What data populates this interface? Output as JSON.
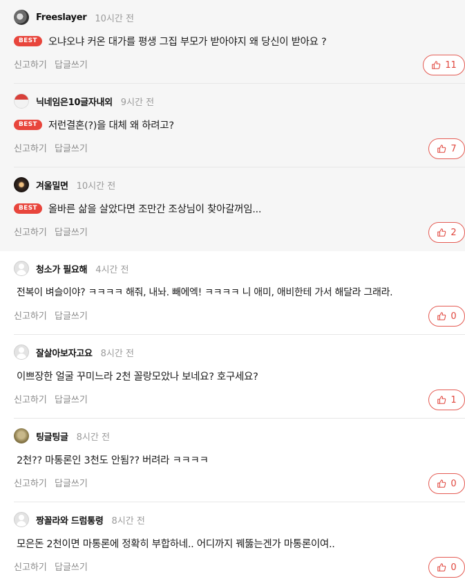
{
  "comments": [
    {
      "nick": "Freeslayer",
      "time": "10시간 전",
      "best": true,
      "badge": "BEST",
      "text": "오냐오냐 커온 대가를 평생 그집 부모가 받아야지 왜 당신이 받아요 ?",
      "report": "신고하기",
      "reply": "답글쓰기",
      "likes": "11"
    },
    {
      "nick": "닉네임은10글자내외",
      "time": "9시간 전",
      "best": true,
      "badge": "BEST",
      "text": "저런결혼(?)을 대체 왜 하려고?",
      "report": "신고하기",
      "reply": "답글쓰기",
      "likes": "7"
    },
    {
      "nick": "겨울밀면",
      "time": "10시간 전",
      "best": true,
      "badge": "BEST",
      "text": "올바른 삶을 살았다면 조만간 조상님이 찾아갈꺼임...",
      "report": "신고하기",
      "reply": "답글쓰기",
      "likes": "2"
    },
    {
      "nick": "청소가 필요해",
      "time": "4시간 전",
      "best": false,
      "text": "전복이 벼슬이야? ㅋㅋㅋㅋ 해줘, 내놔. 빼에엑! ㅋㅋㅋㅋ 니 애미, 애비한테 가서 해달라 그래라.",
      "report": "신고하기",
      "reply": "답글쓰기",
      "likes": "0"
    },
    {
      "nick": "잘살아보자고요",
      "time": "8시간 전",
      "best": false,
      "text": "이쁘장한 얼굴 꾸미느라 2천 꼴랑모았나 보네요? 호구세요?",
      "report": "신고하기",
      "reply": "답글쓰기",
      "likes": "1"
    },
    {
      "nick": "팅글팅글",
      "time": "8시간 전",
      "best": false,
      "text": "2천?? 마통론인 3천도 안됨?? 버려라 ㅋㅋㅋㅋ",
      "report": "신고하기",
      "reply": "답글쓰기",
      "likes": "0"
    },
    {
      "nick": "짱꼴라와 드럼통령",
      "time": "8시간 전",
      "best": false,
      "text": "모은돈 2천이면 마통론에 정확히 부합하네.. 어디까지 꿰뚫는겐가 마통론이여..",
      "report": "신고하기",
      "reply": "답글쓰기",
      "likes": "0"
    }
  ],
  "icons": {
    "like": "thumbs-up-icon",
    "avatar": "avatar"
  },
  "colors": {
    "accent": "#e8453c",
    "best_bg": "#f6f6f6",
    "muted": "#8a8a8a"
  }
}
